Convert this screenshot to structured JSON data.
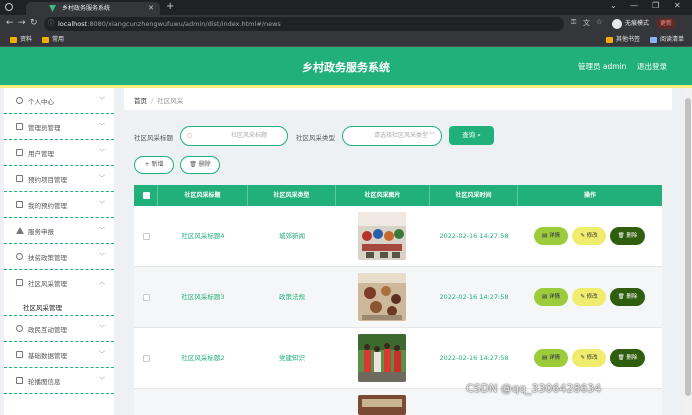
{
  "browser": {
    "tab_title": "乡村政务服务系统",
    "url_host": "localhost",
    "url_path": ":8080/xiangcunzhengwufuwu/admin/dist/index.html#/news",
    "incognito_label": "无痕模式",
    "update_label": "更新",
    "bookmarks": [
      "资料",
      "常用"
    ],
    "bookmarks_right": [
      "其他书签",
      "阅读清单"
    ]
  },
  "header": {
    "title": "乡村政务服务系统",
    "user_label": "管理员 admin",
    "logout_label": "退出登录"
  },
  "sidebar": {
    "items": [
      {
        "label": "个人中心"
      },
      {
        "label": "管理员管理"
      },
      {
        "label": "用户管理"
      },
      {
        "label": "预约项目管理"
      },
      {
        "label": "我的预约管理"
      },
      {
        "label": "服务申报"
      },
      {
        "label": "扶贫政策管理"
      },
      {
        "label": "社区风采管理"
      },
      {
        "label": "政民互动管理"
      },
      {
        "label": "基础数据管理"
      },
      {
        "label": "轮播图信息"
      }
    ],
    "active_sub": "社区风采管理"
  },
  "breadcrumb": {
    "home": "首页",
    "separator": "/",
    "current": "社区风采"
  },
  "search": {
    "title_label": "社区风采标题",
    "title_placeholder": "社区风采标题",
    "type_label": "社区风采类型",
    "type_placeholder": "请选择社区风采类型",
    "query_label": "查询"
  },
  "actions": {
    "add_label": "新增",
    "delete_label": "删除"
  },
  "table": {
    "headers": [
      "社区风采标题",
      "社区风采类型",
      "社区风采图片",
      "社区风采时间",
      "操作"
    ],
    "rows": [
      {
        "title": "社区风采标题4",
        "type": "城郊新闻",
        "time": "2022-02-16 14:27:58"
      },
      {
        "title": "社区风采标题3",
        "type": "政策法规",
        "time": "2022-02-16 14:27:58"
      },
      {
        "title": "社区风采标题2",
        "type": "党建知识",
        "time": "2022-02-16 14:27:58"
      }
    ],
    "row_actions": {
      "detail": "详情",
      "edit": "修改",
      "delete": "删除"
    }
  },
  "watermark": "CSDN @qq_3306428634",
  "colors": {
    "primary": "#22b07a",
    "accent_yellow": "#f5ee7a",
    "detail_btn": "#9ccc3c",
    "edit_btn": "#f0ed6e",
    "delete_btn": "#2f5f0e"
  }
}
